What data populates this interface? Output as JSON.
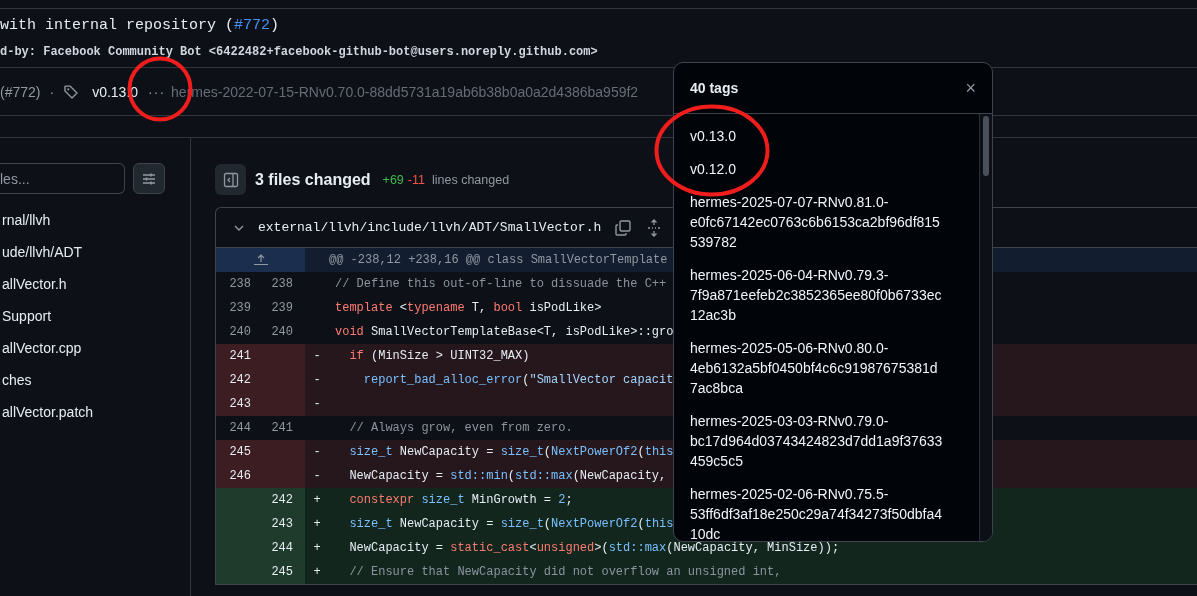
{
  "commit": {
    "title": "with internal repository (",
    "title_link": "#772",
    "title_end": ")",
    "trailer": "d-by: Facebook Community Bot <6422482+facebook-github-bot@users.noreply.github.com>"
  },
  "meta": {
    "pr": "(#772)",
    "separator": "·",
    "tag": "v0.13.0",
    "more": "···",
    "other_tag": "hermes-2022-07-15-RNv0.70.0-88dd5731a19ab6b38b0a0a2d4386ba959f2"
  },
  "sidebar": {
    "filter": {
      "placeholder": "les..."
    },
    "items": [
      {
        "label": "rnal/llvh"
      },
      {
        "label": "ude/llvh/ADT"
      },
      {
        "label": "allVector.h"
      },
      {
        "label": "Support"
      },
      {
        "label": "allVector.cpp"
      },
      {
        "label": "ches"
      },
      {
        "label": "allVector.patch"
      }
    ]
  },
  "summary": {
    "files": "3 files changed",
    "added": "+69",
    "removed": "-11",
    "label": "lines changed"
  },
  "file": {
    "path": "external/llvh/include/llvh/ADT/SmallVector.h",
    "expanded": true
  },
  "hunk": "@@ -238,12 +238,16 @@ class SmallVectorTemplate",
  "lines": [
    {
      "kind": "context",
      "old": "238",
      "new": "238",
      "tokens": [
        {
          "t": "// Define this out-of-line to dissuade the C++",
          "kind": "comment"
        }
      ]
    },
    {
      "kind": "context",
      "old": "239",
      "new": "239",
      "tokens": [
        {
          "t": "template",
          "kind": "keyword"
        },
        {
          "t": " <",
          "kind": "plain"
        },
        {
          "t": "typename",
          "kind": "keyword"
        },
        {
          "t": " T, ",
          "kind": "plain"
        },
        {
          "t": "bool",
          "kind": "keyword"
        },
        {
          "t": " isPodLike>",
          "kind": "plain"
        }
      ]
    },
    {
      "kind": "context",
      "old": "240",
      "new": "240",
      "tokens": [
        {
          "t": "void",
          "kind": "keyword"
        },
        {
          "t": " SmallVectorTemplateBase<T, isPodLike>::gro",
          "kind": "plain"
        }
      ]
    },
    {
      "kind": "del",
      "old": "241",
      "sign": "-",
      "tokens": [
        {
          "t": "  if",
          "kind": "keyword"
        },
        {
          "t": " (MinSize > UINT32_MAX)",
          "kind": "plain"
        }
      ]
    },
    {
      "kind": "del",
      "old": "242",
      "sign": "-",
      "tokens": [
        {
          "t": "    report_bad_alloc_error",
          "kind": "entity"
        },
        {
          "t": "(",
          "kind": "plain"
        },
        {
          "t": "\"SmallVector capacit",
          "kind": "string"
        }
      ]
    },
    {
      "kind": "del",
      "old": "243",
      "sign": "-"
    },
    {
      "kind": "context",
      "old": "244",
      "new": "241",
      "tokens": [
        {
          "t": "  // Always grow, even from zero.",
          "kind": "comment"
        }
      ]
    },
    {
      "kind": "del",
      "old": "245",
      "sign": "-",
      "tokens": [
        {
          "t": "  size_t",
          "kind": "entity"
        },
        {
          "t": " NewCapacity = ",
          "kind": "plain"
        },
        {
          "t": "size_t",
          "kind": "entity"
        },
        {
          "t": "(",
          "kind": "plain"
        },
        {
          "t": "NextPowerOf2",
          "kind": "entity"
        },
        {
          "t": "(",
          "kind": "plain"
        },
        {
          "t": "this",
          "kind": "entity"
        }
      ]
    },
    {
      "kind": "del",
      "old": "246",
      "sign": "-",
      "tokens": [
        {
          "t": "  NewCapacity = ",
          "kind": "plain"
        },
        {
          "t": "std::min",
          "kind": "entity"
        },
        {
          "t": "(",
          "kind": "plain"
        },
        {
          "t": "std::max",
          "kind": "entity"
        },
        {
          "t": "(NewCapacity,",
          "kind": "plain"
        }
      ]
    },
    {
      "kind": "add",
      "new": "242",
      "sign": "+",
      "tokens": [
        {
          "t": "  constexpr",
          "kind": "keyword"
        },
        {
          "t": " size_t",
          "kind": "entity"
        },
        {
          "t": " MinGrowth = ",
          "kind": "plain"
        },
        {
          "t": "2",
          "kind": "entity"
        },
        {
          "t": ";",
          "kind": "plain"
        }
      ]
    },
    {
      "kind": "add",
      "new": "243",
      "sign": "+",
      "tokens": [
        {
          "t": "  size_t",
          "kind": "entity"
        },
        {
          "t": " NewCapacity = ",
          "kind": "plain"
        },
        {
          "t": "size_t",
          "kind": "entity"
        },
        {
          "t": "(",
          "kind": "plain"
        },
        {
          "t": "NextPowerOf2",
          "kind": "entity"
        },
        {
          "t": "(",
          "kind": "plain"
        },
        {
          "t": "this",
          "kind": "entity"
        }
      ]
    },
    {
      "kind": "add",
      "new": "244",
      "sign": "+",
      "tokens": [
        {
          "t": "  NewCapacity = ",
          "kind": "plain"
        },
        {
          "t": "static_cast",
          "kind": "keyword"
        },
        {
          "t": "<",
          "kind": "plain"
        },
        {
          "t": "unsigned",
          "kind": "keyword"
        },
        {
          "t": ">(",
          "kind": "plain"
        },
        {
          "t": "std::max",
          "kind": "entity"
        },
        {
          "t": "(NewCapacity, MinSize));",
          "kind": "plain"
        }
      ]
    },
    {
      "kind": "add",
      "new": "245",
      "sign": "+",
      "tokens": [
        {
          "t": "  // Ensure that NewCapacity did not overflow an unsigned int,",
          "kind": "comment"
        }
      ]
    }
  ],
  "popup": {
    "title": "40 tags",
    "close": "×",
    "tags": [
      "v0.13.0",
      "v0.12.0",
      "hermes-2025-07-07-RNv0.81.0-e0fc67142ec0763c6b6153ca2bf96df815539782",
      "hermes-2025-06-04-RNv0.79.3-7f9a871eefeb2c3852365ee80f0b6733ec12ac3b",
      "hermes-2025-05-06-RNv0.80.0-4eb6132a5bf0450bf4c6c91987675381d7ac8bca",
      "hermes-2025-03-03-RNv0.79.0-bc17d964d03743424823d7dd1a9f37633459c5c5",
      "hermes-2025-02-06-RNv0.75.5-53ff6df3af18e250c29a74f34273f50dbfa410dc"
    ]
  },
  "annotations": [
    {
      "kind": "circle"
    },
    {
      "kind": "circle"
    }
  ]
}
